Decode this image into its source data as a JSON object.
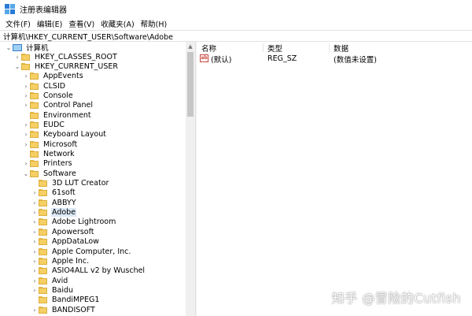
{
  "window": {
    "title": "注册表编辑器"
  },
  "menu": [
    "文件(F)",
    "编辑(E)",
    "查看(V)",
    "收藏夹(A)",
    "帮助(H)"
  ],
  "address": "计算机\\HKEY_CURRENT_USER\\Software\\Adobe",
  "tree": {
    "root": "计算机",
    "items": [
      {
        "label": "HKEY_CLASSES_ROOT",
        "expander": "collapsed"
      },
      {
        "label": "HKEY_CURRENT_USER",
        "expander": "expanded"
      },
      {
        "label": "AppEvents",
        "expander": "collapsed"
      },
      {
        "label": "CLSID",
        "expander": "collapsed"
      },
      {
        "label": "Console",
        "expander": "collapsed"
      },
      {
        "label": "Control Panel",
        "expander": "collapsed"
      },
      {
        "label": "Environment",
        "expander": "none"
      },
      {
        "label": "EUDC",
        "expander": "collapsed"
      },
      {
        "label": "Keyboard Layout",
        "expander": "collapsed"
      },
      {
        "label": "Microsoft",
        "expander": "collapsed"
      },
      {
        "label": "Network",
        "expander": "none"
      },
      {
        "label": "Printers",
        "expander": "collapsed"
      },
      {
        "label": "Software",
        "expander": "expanded"
      },
      {
        "label": "3D LUT Creator",
        "expander": "none"
      },
      {
        "label": "61soft",
        "expander": "collapsed"
      },
      {
        "label": "ABBYY",
        "expander": "collapsed"
      },
      {
        "label": "Adobe",
        "expander": "collapsed",
        "selected": true
      },
      {
        "label": "Adobe Lightroom",
        "expander": "collapsed"
      },
      {
        "label": "Apowersoft",
        "expander": "collapsed"
      },
      {
        "label": "AppDataLow",
        "expander": "collapsed"
      },
      {
        "label": "Apple Computer, Inc.",
        "expander": "collapsed"
      },
      {
        "label": "Apple Inc.",
        "expander": "collapsed"
      },
      {
        "label": "ASIO4ALL v2 by Wuschel",
        "expander": "collapsed"
      },
      {
        "label": "Avid",
        "expander": "collapsed"
      },
      {
        "label": "Baidu",
        "expander": "collapsed"
      },
      {
        "label": "BandiMPEG1",
        "expander": "none"
      },
      {
        "label": "BANDISOFT",
        "expander": "collapsed"
      }
    ]
  },
  "list": {
    "headers": {
      "name": "名称",
      "type": "类型",
      "data": "数据"
    },
    "rows": [
      {
        "icon": "ab",
        "name": "(默认)",
        "type": "REG_SZ",
        "data": "(数值未设置)"
      }
    ]
  },
  "watermark": "知乎 @冒险的Cutfish",
  "colors": {
    "folder": "#f5cf63",
    "selection": "#dce9f7",
    "scrollbar_thumb": "#c6c6c6"
  }
}
